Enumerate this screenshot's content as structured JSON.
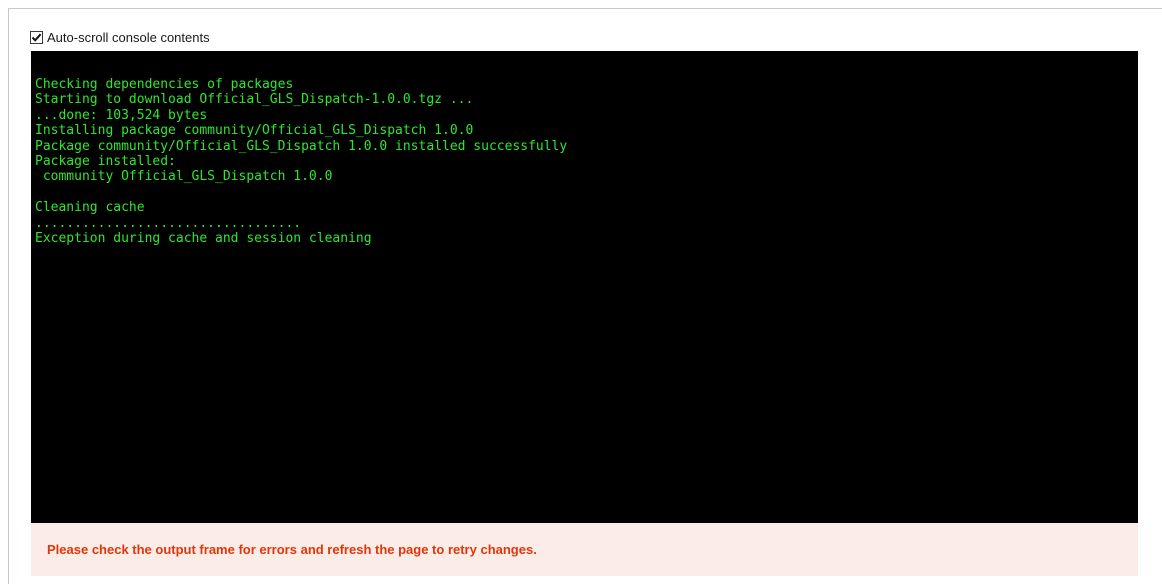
{
  "autoscroll": {
    "label": "Auto-scroll console contents",
    "checked": true
  },
  "console": {
    "lines": [
      "Checking dependencies of packages",
      "Starting to download Official_GLS_Dispatch-1.0.0.tgz ...",
      "...done: 103,524 bytes",
      "Installing package community/Official_GLS_Dispatch 1.0.0",
      "Package community/Official_GLS_Dispatch 1.0.0 installed successfully",
      "Package installed:",
      " community Official_GLS_Dispatch 1.0.0",
      "",
      "Cleaning cache",
      "..................................",
      "Exception during cache and session cleaning"
    ],
    "text_color": "#2fe62f",
    "background_color": "#000000"
  },
  "status": {
    "message": "Please check the output frame for errors and refresh the page to retry changes.",
    "text_color": "#e0360b",
    "background_color": "#fbece7"
  }
}
